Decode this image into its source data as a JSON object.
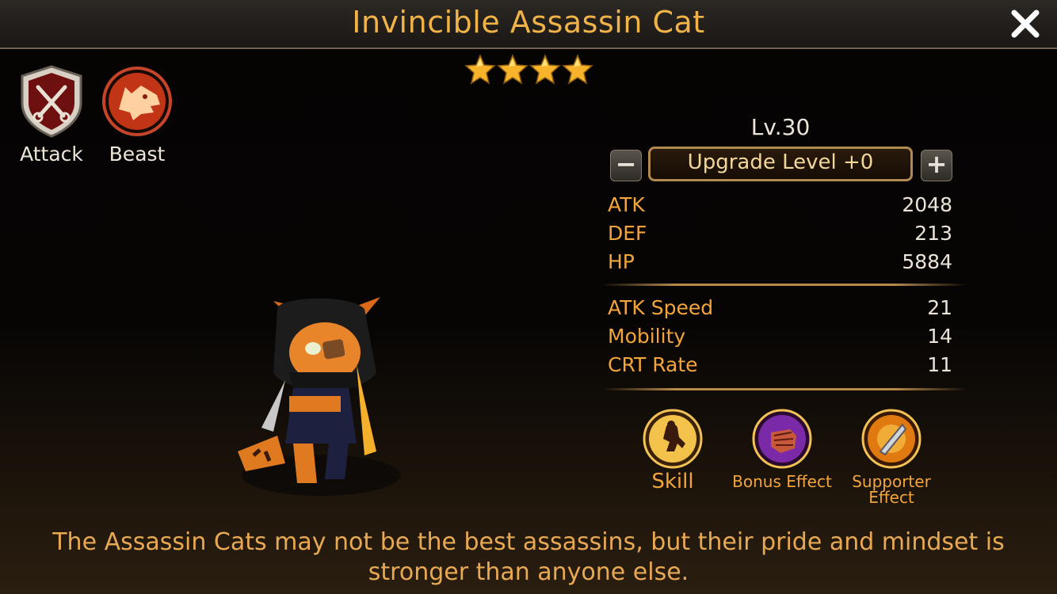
{
  "header": {
    "title": "Invincible Assassin Cat",
    "close_icon": "close-icon"
  },
  "stars": {
    "count": 4,
    "max": 4,
    "color": "#f7b42a"
  },
  "badges": [
    {
      "label": "Attack",
      "icon": "crossed-swords-icon"
    },
    {
      "label": "Beast",
      "icon": "wolf-head-icon"
    }
  ],
  "level": {
    "text": "Lv.30"
  },
  "upgrade": {
    "label": "Upgrade Level +0",
    "minus": "−",
    "plus": "+"
  },
  "stats_primary": [
    {
      "name": "ATK",
      "value": "2048"
    },
    {
      "name": "DEF",
      "value": "213"
    },
    {
      "name": "HP",
      "value": "5884"
    }
  ],
  "stats_secondary": [
    {
      "name": "ATK Speed",
      "value": "21"
    },
    {
      "name": "Mobility",
      "value": "14"
    },
    {
      "name": "CRT Rate",
      "value": "11"
    }
  ],
  "skills": [
    {
      "label": "Skill",
      "icon": "kneeling-figure-icon"
    },
    {
      "label": "Bonus Effect",
      "icon": "fist-icon"
    },
    {
      "label": "Supporter Effect",
      "icon": "shield-dagger-icon"
    }
  ],
  "description": "The Assassin Cats may not be the best assassins, but their pride and mindset is stronger than anyone else.",
  "colors": {
    "title": "#f1b348",
    "stat_name": "#f2a53d",
    "text": "#ece4d8",
    "description": "#e9a953"
  }
}
